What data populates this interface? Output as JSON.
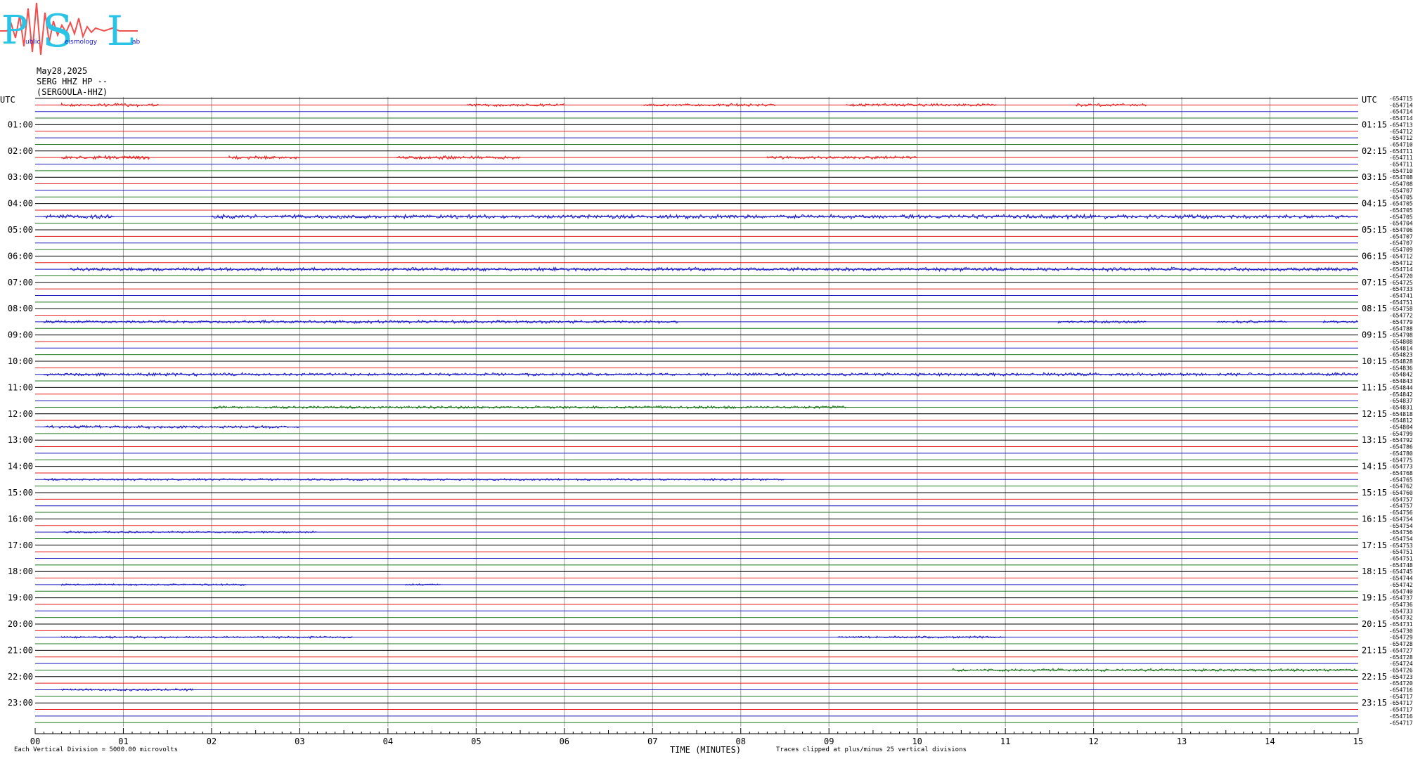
{
  "logo": {
    "initials": [
      "P",
      "S",
      "L"
    ],
    "words": [
      "ublic",
      "eismology",
      "ab"
    ]
  },
  "header": {
    "date": "May28,2025",
    "channel": "SERG HHZ HP --",
    "station": "(SERGOULA-HHZ)"
  },
  "chart_data": {
    "type": "line",
    "title": "",
    "left_axis_label": "UTC",
    "right_axis_label": "UTC",
    "left_time_labels": [
      "01:00",
      "02:00",
      "03:00",
      "04:00",
      "05:00",
      "06:00",
      "07:00",
      "08:00",
      "09:00",
      "10:00",
      "11:00",
      "12:00",
      "13:00",
      "14:00",
      "15:00",
      "16:00",
      "17:00",
      "18:00",
      "19:00",
      "20:00",
      "21:00",
      "22:00",
      "23:00"
    ],
    "right_time_labels": [
      "01:15",
      "02:15",
      "03:15",
      "04:15",
      "05:15",
      "06:15",
      "07:15",
      "08:15",
      "09:15",
      "10:15",
      "11:15",
      "12:15",
      "13:15",
      "14:15",
      "15:15",
      "16:15",
      "17:15",
      "18:15",
      "19:15",
      "20:15",
      "21:15",
      "22:15",
      "23:15"
    ],
    "x_ticks": [
      "00",
      "01",
      "02",
      "03",
      "04",
      "05",
      "06",
      "07",
      "08",
      "09",
      "10",
      "11",
      "12",
      "13",
      "14",
      "15"
    ],
    "xlabel": "TIME (MINUTES)",
    "xlim": [
      0,
      15
    ],
    "trace_colors": [
      "#000000",
      "#e81e1e",
      "#1a1ac8",
      "#1e7a1e"
    ],
    "gridline_color": "#9a9a9a",
    "trace_count": 96,
    "activity": [
      {
        "trace": 1,
        "segments": [
          [
            0.3,
            1.4
          ],
          [
            4.9,
            6.0
          ],
          [
            6.9,
            8.4
          ],
          [
            9.2,
            10.9
          ],
          [
            11.8,
            12.6
          ]
        ],
        "amp": 1.6
      },
      {
        "trace": 9,
        "segments": [
          [
            0.3,
            1.3
          ],
          [
            1.0,
            1.3
          ],
          [
            2.2,
            3.0
          ],
          [
            4.1,
            5.5
          ],
          [
            8.3,
            10.0
          ]
        ],
        "amp": 1.8
      },
      {
        "trace": 18,
        "segments": [
          [
            0.1,
            0.9
          ],
          [
            2.0,
            15.0
          ]
        ],
        "amp": 2.2
      },
      {
        "trace": 26,
        "segments": [
          [
            0.4,
            15.0
          ]
        ],
        "amp": 2.0
      },
      {
        "trace": 34,
        "segments": [
          [
            11.6,
            12.6
          ],
          [
            13.4,
            14.2
          ],
          [
            14.6,
            15.0
          ]
        ],
        "amp": 1.5
      },
      {
        "trace": 34,
        "segments": [
          [
            0.1,
            7.3
          ]
        ],
        "amp": 1.6
      },
      {
        "trace": 42,
        "segments": [
          [
            0.1,
            15.0
          ]
        ],
        "amp": 1.7
      },
      {
        "trace": 47,
        "segments": [
          [
            2.0,
            9.2
          ]
        ],
        "amp": 1.5
      },
      {
        "trace": 50,
        "segments": [
          [
            0.1,
            3.0
          ]
        ],
        "amp": 1.6
      },
      {
        "trace": 58,
        "segments": [
          [
            0.1,
            8.5
          ]
        ],
        "amp": 1.1
      },
      {
        "trace": 66,
        "segments": [
          [
            0.3,
            3.2
          ]
        ],
        "amp": 1.0
      },
      {
        "trace": 74,
        "segments": [
          [
            0.3,
            2.4
          ],
          [
            4.2,
            4.6
          ]
        ],
        "amp": 1.0
      },
      {
        "trace": 82,
        "segments": [
          [
            0.3,
            3.6
          ],
          [
            9.1,
            11.0
          ]
        ],
        "amp": 1.2
      },
      {
        "trace": 87,
        "segments": [
          [
            10.4,
            15.0
          ]
        ],
        "amp": 1.5
      },
      {
        "trace": 90,
        "segments": [
          [
            0.3,
            1.8
          ]
        ],
        "amp": 1.3
      }
    ],
    "right_values": [
      "-6547157",
      "-6547148",
      "-6547145",
      "-6547141",
      "-6547132",
      "-6547126",
      "-6547126",
      "-6547107",
      "-6547112",
      "-6547115",
      "-6547117",
      "-6547104",
      "-6547084",
      "-6547088",
      "-6547074",
      "-6547059",
      "-6547058",
      "-6547053",
      "-6547051",
      "-6547046",
      "-6547066",
      "-6547071",
      "-6547071",
      "-6547094",
      "-6547123",
      "-6547122",
      "-6547149",
      "-6547204",
      "-6547252",
      "-6547337",
      "-6547410",
      "-6547513",
      "-6547583",
      "-6547723",
      "-6547791",
      "-6547882",
      "-6547982",
      "-6548085",
      "-6548146",
      "-6548230",
      "-6548288",
      "-6548366",
      "-6548420",
      "-6548439",
      "-6548441",
      "-6548422",
      "-6548376",
      "-6548313",
      "-6548183",
      "-6548121",
      "-6548048",
      "-6547999",
      "-6547922",
      "-6547861",
      "-6547803",
      "-6547756",
      "-6547731",
      "-6547687",
      "-6547653",
      "-6547627",
      "-6547607",
      "-6547577",
      "-6547572",
      "-6547564",
      "-6547543",
      "-6547541",
      "-6547569",
      "-6547541",
      "-6547534",
      "-6547518",
      "-6547516",
      "-6547484",
      "-6547455",
      "-6547447",
      "-6547428",
      "-6547409",
      "-6547378",
      "-6547365",
      "-6547331",
      "-6547321",
      "-6547311",
      "-6547304",
      "-6547295",
      "-6547280",
      "-6547271",
      "-6547286",
      "-6547247",
      "-6547268",
      "-6547238",
      "-6547202",
      "-6547165",
      "-6547174",
      "-6547177",
      "-6547178",
      "-6547167",
      "-6547179"
    ],
    "footer_left": "Each Vertical Division = 5000.00 microvolts",
    "footer_right": "Traces clipped at plus/minus 25 vertical divisions"
  }
}
